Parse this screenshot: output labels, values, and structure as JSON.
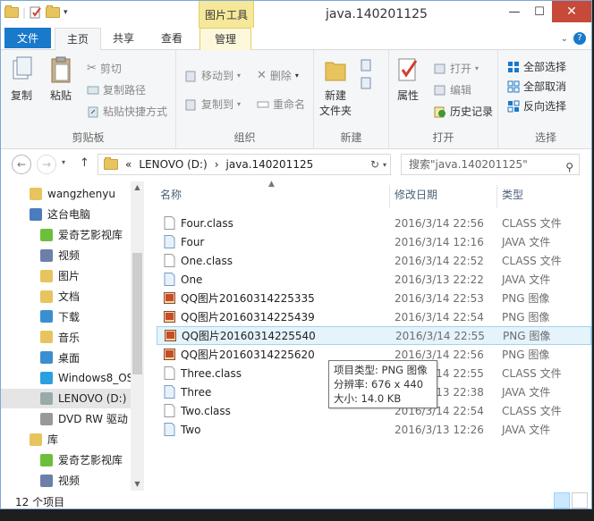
{
  "window": {
    "title": "java.140201125",
    "context_tab_title": "图片工具",
    "controls": {
      "minimize": "—",
      "maximize": "☐",
      "close": "✕"
    }
  },
  "tabs": {
    "file": "文件",
    "home": "主页",
    "share": "共享",
    "view": "查看",
    "manage": "管理"
  },
  "ribbon": {
    "clipboard": {
      "label": "剪贴板",
      "copy": "复制",
      "paste": "粘贴",
      "cut": "剪切",
      "copy_path": "复制路径",
      "paste_shortcut": "粘贴快捷方式"
    },
    "organize": {
      "label": "组织",
      "move_to": "移动到",
      "copy_to": "复制到",
      "delete": "删除",
      "rename": "重命名"
    },
    "new": {
      "label": "新建",
      "new_folder_line1": "新建",
      "new_folder_line2": "文件夹"
    },
    "open": {
      "label": "打开",
      "properties": "属性",
      "open": "打开",
      "edit": "编辑",
      "history": "历史记录"
    },
    "select": {
      "label": "选择",
      "select_all": "全部选择",
      "select_none": "全部取消",
      "invert": "反向选择"
    }
  },
  "address": {
    "path": [
      "«",
      "LENOVO (D:)",
      "›",
      "java.140201125"
    ],
    "search_placeholder": "搜索\"java.140201125\""
  },
  "nav": {
    "items": [
      {
        "label": "wangzhenyu",
        "icon": "user-folder-icon",
        "indent": 32
      },
      {
        "label": "这台电脑",
        "icon": "computer-icon",
        "indent": 32
      },
      {
        "label": "爱奇艺影视库",
        "icon": "media-library-icon",
        "indent": 44
      },
      {
        "label": "视频",
        "icon": "video-folder-icon",
        "indent": 44
      },
      {
        "label": "图片",
        "icon": "pictures-folder-icon",
        "indent": 44
      },
      {
        "label": "文档",
        "icon": "documents-folder-icon",
        "indent": 44
      },
      {
        "label": "下载",
        "icon": "downloads-folder-icon",
        "indent": 44
      },
      {
        "label": "音乐",
        "icon": "music-folder-icon",
        "indent": 44
      },
      {
        "label": "桌面",
        "icon": "desktop-folder-icon",
        "indent": 44
      },
      {
        "label": "Windows8_OS",
        "icon": "windows-drive-icon",
        "indent": 44
      },
      {
        "label": "LENOVO (D:)",
        "icon": "drive-icon",
        "indent": 44
      },
      {
        "label": "DVD RW 驱动",
        "icon": "dvd-drive-icon",
        "indent": 44
      },
      {
        "label": "库",
        "icon": "libraries-icon",
        "indent": 32
      },
      {
        "label": "爱奇艺影视库",
        "icon": "media-library-icon",
        "indent": 44
      },
      {
        "label": "视频",
        "icon": "video-folder-icon",
        "indent": 44
      }
    ],
    "selected": 10
  },
  "columns": {
    "name": "名称",
    "date": "修改日期",
    "type": "类型"
  },
  "files": [
    {
      "name": "Four.class",
      "date": "2016/3/14 22:56",
      "type": "CLASS 文件",
      "icon": "file-icon"
    },
    {
      "name": "Four",
      "date": "2016/3/14 12:16",
      "type": "JAVA 文件",
      "icon": "java-file-icon"
    },
    {
      "name": "One.class",
      "date": "2016/3/14 22:52",
      "type": "CLASS 文件",
      "icon": "file-icon"
    },
    {
      "name": "One",
      "date": "2016/3/13 22:22",
      "type": "JAVA 文件",
      "icon": "java-file-icon"
    },
    {
      "name": "QQ图片20160314225335",
      "date": "2016/3/14 22:53",
      "type": "PNG 图像",
      "icon": "png-image-icon"
    },
    {
      "name": "QQ图片20160314225439",
      "date": "2016/3/14 22:54",
      "type": "PNG 图像",
      "icon": "png-image-icon"
    },
    {
      "name": "QQ图片20160314225540",
      "date": "2016/3/14 22:55",
      "type": "PNG 图像",
      "icon": "png-image-icon"
    },
    {
      "name": "QQ图片20160314225620",
      "date": "2016/3/14 22:56",
      "type": "PNG 图像",
      "icon": "png-image-icon"
    },
    {
      "name": "Three.class",
      "date": "2016/3/14 22:55",
      "type": "CLASS 文件",
      "icon": "file-icon"
    },
    {
      "name": "Three",
      "date": "2016/3/13 22:38",
      "type": "JAVA 文件",
      "icon": "java-file-icon"
    },
    {
      "name": "Two.class",
      "date": "2016/3/14 22:54",
      "type": "CLASS 文件",
      "icon": "file-icon"
    },
    {
      "name": "Two",
      "date": "2016/3/13 12:26",
      "type": "JAVA 文件",
      "icon": "java-file-icon"
    }
  ],
  "selected_file": 6,
  "tooltip": {
    "line1": "项目类型: PNG 图像",
    "line2": "分辨率: 676 x 440",
    "line3": "大小: 14.0 KB"
  },
  "status": {
    "count": "12 个项目"
  },
  "colors": {
    "accent": "#1979ca",
    "context_tab": "#f5e89a",
    "selection": "#e5f3fb",
    "close": "#c7493a"
  }
}
